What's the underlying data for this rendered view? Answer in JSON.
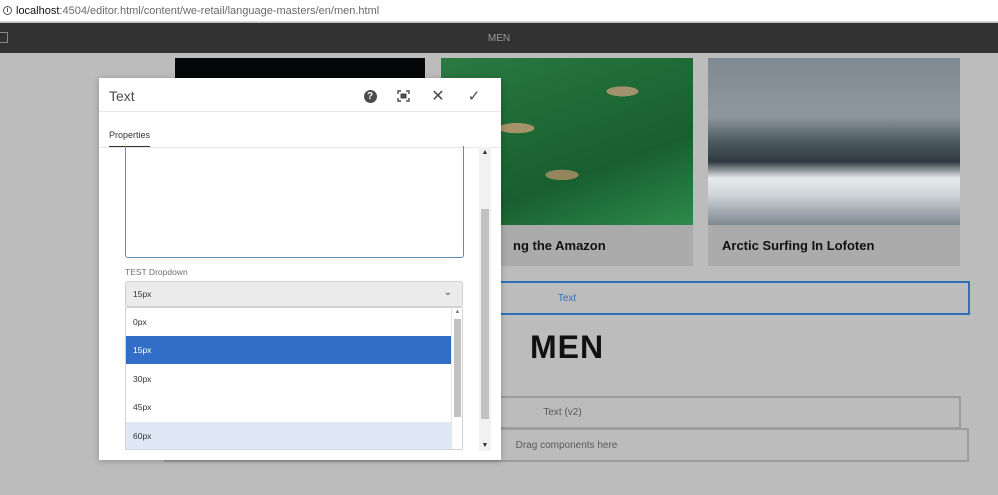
{
  "browser": {
    "url_host": "localhost",
    "url_path": ":4504/editor.html/content/we-retail/language-masters/en/men.html"
  },
  "toolbar": {
    "page_title": "MEN"
  },
  "page": {
    "cards": [
      {
        "title": ""
      },
      {
        "title": "ng the Amazon"
      },
      {
        "title": "Arctic Surfing In Lofoten"
      }
    ],
    "text_component": "Text",
    "heading": "MEN",
    "text_v2": "Text (v2)",
    "drag_here": "Drag components here"
  },
  "dialog": {
    "title": "Text",
    "tab": "Properties",
    "dropdown": {
      "label": "TEST Dropdown",
      "value": "15px",
      "options": [
        "0px",
        "15px",
        "30px",
        "45px",
        "60px"
      ],
      "selected_index": 1,
      "hovered_index": 4
    }
  },
  "icons": {
    "help": "help-icon",
    "fullscreen": "fullscreen-icon",
    "close": "close-icon",
    "done": "check-icon",
    "chevron": "chevron-down-icon"
  },
  "colors": {
    "toolbar": "#323232",
    "accent": "#326ec8",
    "selection_border": "#2d6fb9"
  }
}
